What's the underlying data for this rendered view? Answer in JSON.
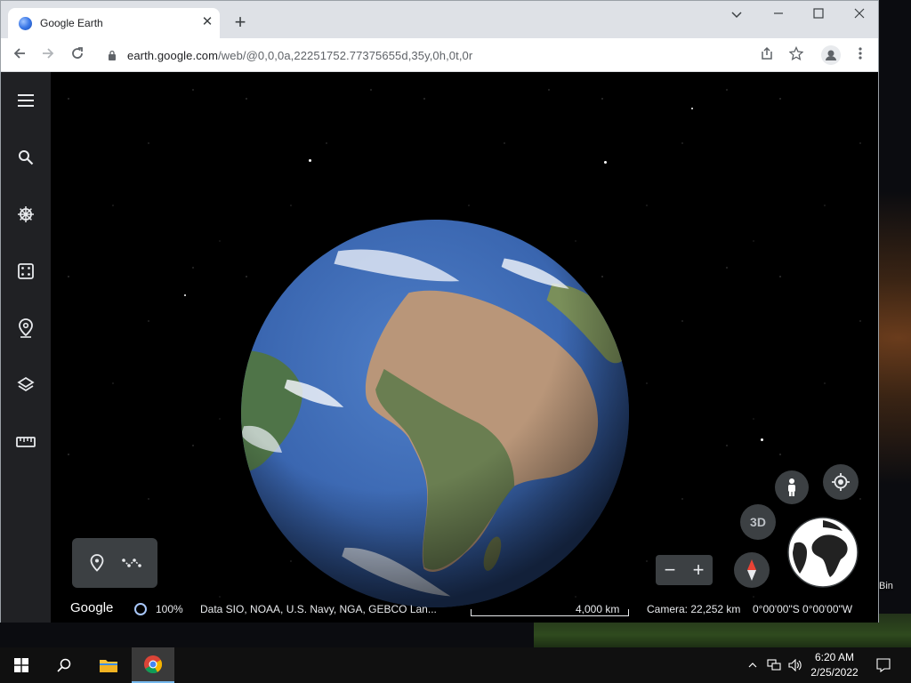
{
  "browser": {
    "tab_title": "Google Earth",
    "url_host": "earth.google.com",
    "url_path": "/web/@0,0,0a,22251752.77375655d,35y,0h,0t,0r"
  },
  "map": {
    "button_3d_label": "3D"
  },
  "statusbar": {
    "logo_text": "Google",
    "load_percent": "100%",
    "attribution": "Data SIO, NOAA, U.S. Navy, NGA, GEBCO  Lan...",
    "scale_label": "4,000 km",
    "camera": "Camera: 22,252 km",
    "coordinates": "0°00'00\"S 0°00'00\"W"
  },
  "desktop": {
    "bin_label": "Bin"
  },
  "taskbar": {
    "time": "6:20 AM",
    "date": "2/25/2022"
  }
}
